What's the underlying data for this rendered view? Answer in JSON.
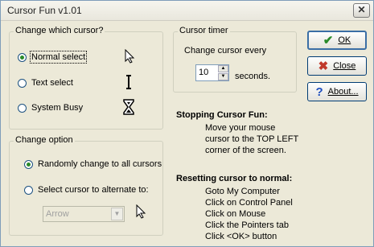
{
  "window": {
    "title": "Cursor Fun v1.01"
  },
  "cursor_group": {
    "legend": "Change which cursor?",
    "options": [
      "Normal select",
      "Text select",
      "System Busy"
    ],
    "selected": 0
  },
  "change_group": {
    "legend": "Change option",
    "options": [
      "Randomly change to all cursors",
      "Select cursor to alternate to:"
    ],
    "selected": 0,
    "combo_value": "Arrow"
  },
  "timer_group": {
    "legend": "Cursor timer",
    "label": "Change cursor every",
    "value": "10",
    "unit": "seconds."
  },
  "buttons": {
    "ok": "OK",
    "close": "Close",
    "about": "About..."
  },
  "stopping": {
    "heading": "Stopping Cursor Fun:",
    "lines": [
      "Move your mouse",
      "cursor to the TOP LEFT",
      "corner of the screen."
    ]
  },
  "resetting": {
    "heading": "Resetting cursor to normal:",
    "lines": [
      "Goto My Computer",
      "Click on Control Panel",
      "Click on Mouse",
      "Click the Pointers tab",
      "Click <OK> button"
    ]
  },
  "colors": {
    "ok_check": "#2a8a2a",
    "close_x": "#c0392b",
    "about_q": "#1f4fbf",
    "radio_dot": "#2a8a2a"
  }
}
